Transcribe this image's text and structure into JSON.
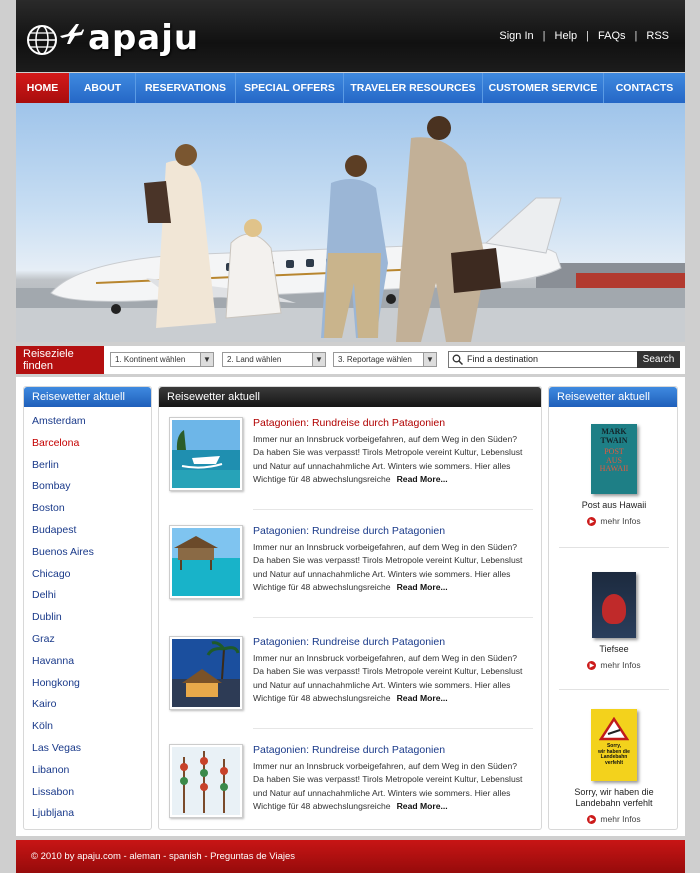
{
  "brand": {
    "name": "apaju"
  },
  "top_links": [
    "Sign In",
    "Help",
    "FAQs",
    "RSS"
  ],
  "nav": [
    {
      "label": "HOME",
      "active": true
    },
    {
      "label": "ABOUT"
    },
    {
      "label": "RESERVATIONS"
    },
    {
      "label": "SPECIAL OFFERS"
    },
    {
      "label": "TRAVELER RESOURCES"
    },
    {
      "label": "CUSTOMER SERVICE"
    },
    {
      "label": "CONTACTS"
    }
  ],
  "search": {
    "label": "Reiseziele finden",
    "select1": "1. Kontinent wählen",
    "select2": "2. Land wählen",
    "select3": "3. Reportage wählen",
    "placeholder": "Find a destination",
    "button": "Search"
  },
  "left": {
    "heading": "Reisewetter aktuell",
    "cities": [
      "Amsterdam",
      "Barcelona",
      "Berlin",
      "Bombay",
      "Boston",
      "Budapest",
      "Buenos Aires",
      "Chicago",
      "Delhi",
      "Dublin",
      "Graz",
      "Havanna",
      "Hongkong",
      "Kairo",
      "Köln",
      "Las Vegas",
      "Libanon",
      "Lissabon",
      "Ljubljana"
    ],
    "active_city": "Barcelona"
  },
  "middle": {
    "heading": "Reisewetter aktuell",
    "articles": [
      {
        "title": "Patagonien: Rundreise durch Patagonien",
        "text": "Immer nur an Innsbruck vorbeigefahren, auf dem Weg in den Süden? Da haben Sie was verpasst! Tirols Metropole vereint Kultur, Lebenslust und Natur auf unnachahmliche Art. Winters wie sommers. Hier alles Wichtige für 48 abwechslungsreiche",
        "more": "Read More..."
      },
      {
        "title": "Patagonien: Rundreise durch Patagonien",
        "text": "Immer nur an Innsbruck vorbeigefahren, auf dem Weg in den Süden? Da haben Sie was verpasst! Tirols Metropole vereint Kultur, Lebenslust und Natur auf unnachahmliche Art. Winters wie sommers. Hier alles Wichtige für 48 abwechslungsreiche",
        "more": "Read More..."
      },
      {
        "title": "Patagonien: Rundreise durch Patagonien",
        "text": "Immer nur an Innsbruck vorbeigefahren, auf dem Weg in den Süden? Da haben Sie was verpasst! Tirols Metropole vereint Kultur, Lebenslust und Natur auf unnachahmliche Art. Winters wie sommers. Hier alles Wichtige für 48 abwechslungsreiche",
        "more": "Read More..."
      },
      {
        "title": "Patagonien: Rundreise durch Patagonien",
        "text": "Immer nur an Innsbruck vorbeigefahren, auf dem Weg in den Süden? Da haben Sie was verpasst! Tirols Metropole vereint Kultur, Lebenslust und Natur auf unnachahmliche Art. Winters wie sommers. Hier alles Wichtige für 48 abwechslungsreiche",
        "more": "Read More..."
      }
    ]
  },
  "right": {
    "heading": "Reisewetter aktuell",
    "books": [
      {
        "title": "Post aus Hawaii",
        "more": "mehr Infos",
        "cover_lines": [
          "MARK",
          "TWAIN",
          "POST",
          "AUS",
          "HAWAII"
        ]
      },
      {
        "title": "Tiefsee",
        "more": "mehr Infos"
      },
      {
        "title": "Sorry, wir haben die Landebahn verfehlt",
        "more": "mehr Infos",
        "cover_lines": [
          "Sorry,",
          "wir haben die",
          "Landebahn",
          "verfehlt"
        ]
      }
    ]
  },
  "footer": {
    "text": "© 2010 by apaju.com - aleman - spanish - Preguntas de Viajes"
  },
  "colors": {
    "nav_blue": "#2f78d6",
    "active_red": "#c41212",
    "header_dark": "#1a1a1a",
    "link_blue": "#1a3a8a"
  }
}
